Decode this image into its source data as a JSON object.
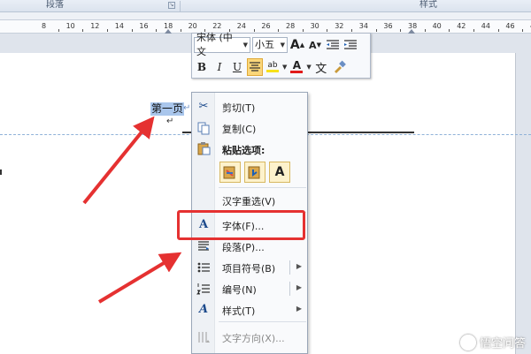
{
  "ribbon": {
    "group_paragraph": "段落",
    "group_styles": "样式",
    "launcher_glyph": "↘"
  },
  "ruler": {
    "labels": [
      "8",
      "10",
      "12",
      "14",
      "16",
      "18",
      "20",
      "22",
      "24",
      "26",
      "28",
      "30",
      "32",
      "34",
      "36",
      "38",
      "40",
      "42",
      "44",
      "46",
      "48"
    ]
  },
  "document": {
    "selected_text": "第一页",
    "para_mark": "↵",
    "para_mark_below": "↵"
  },
  "mini_toolbar": {
    "font_name": "宋体 (中文",
    "font_size": "小五",
    "grow_label": "A",
    "shrink_label": "A",
    "bold": "B",
    "italic": "I",
    "underline": "U",
    "highlight": "ab",
    "font_color": "A",
    "phonetic": "文"
  },
  "context_menu": {
    "cut": "剪切(T)",
    "copy": "复制(C)",
    "paste_header": "粘贴选项:",
    "paste_keep_source": "",
    "paste_merge": "",
    "paste_text_only": "A",
    "reconvert": "汉字重选(V)",
    "font": "字体(F)...",
    "paragraph": "段落(P)...",
    "bullets": "项目符号(B)",
    "numbering": "编号(N)",
    "styles": "样式(T)",
    "text_direction": "文字方向(X)..."
  },
  "watermark": {
    "text": "悟空问答"
  },
  "colors": {
    "highlight_red": "#e53131",
    "selection": "#a9c6ec",
    "menu_bg": "#f9fafc"
  }
}
